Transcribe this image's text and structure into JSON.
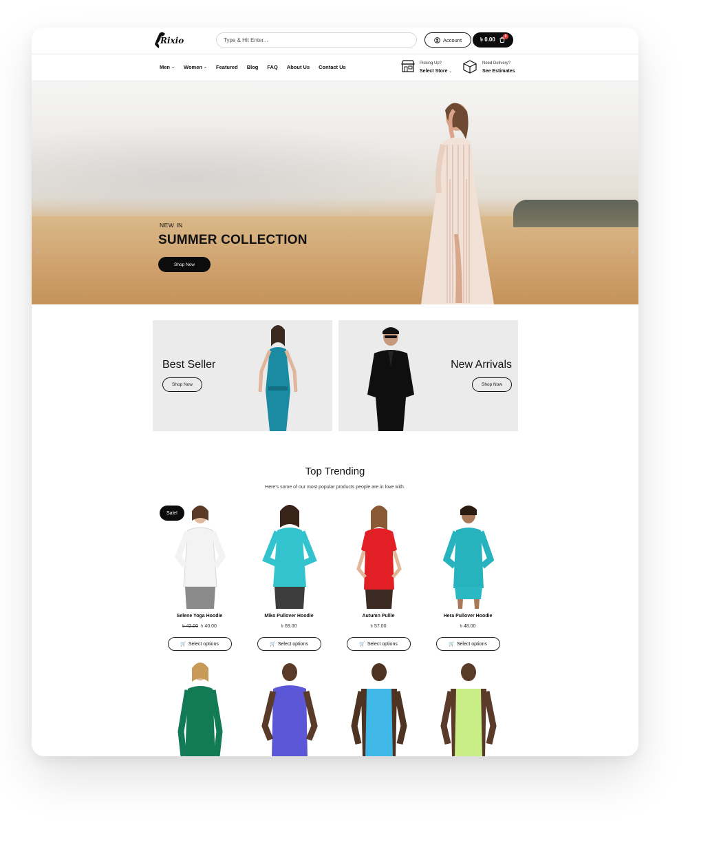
{
  "brand": {
    "logo_text": "Rixio"
  },
  "header": {
    "search_placeholder": "Type & Hit Enter...",
    "account_label": "Account",
    "cart_total": "৳ 0.00",
    "cart_count": "0"
  },
  "nav": {
    "items": [
      {
        "label": "Men",
        "has_dropdown": true
      },
      {
        "label": "Women",
        "has_dropdown": true
      },
      {
        "label": "Featured",
        "has_dropdown": false
      },
      {
        "label": "Blog",
        "has_dropdown": false
      },
      {
        "label": "FAQ",
        "has_dropdown": false
      },
      {
        "label": "About Us",
        "has_dropdown": false
      },
      {
        "label": "Contact Us",
        "has_dropdown": false
      }
    ],
    "store": {
      "line1": "Picking Up?",
      "line2": "Select Store"
    },
    "delivery": {
      "line1": "Need Delivery?",
      "line2": "See Estimates"
    }
  },
  "hero": {
    "kicker": "NEW IN",
    "title": "SUMMER COLLECTION",
    "button": "Shop Now"
  },
  "promos": [
    {
      "title": "Best Seller",
      "button": "Shop Now"
    },
    {
      "title": "New Arrivals",
      "button": "Shop Now"
    }
  ],
  "trending": {
    "title": "Top Trending",
    "subtitle": "Here's some of our most popular products people are in love with.",
    "sale_badge": "Sale!",
    "button_label": "Select options",
    "products": [
      {
        "name": "Selene Yoga Hoodie",
        "old_price": "৳ 42.00",
        "price": "৳ 40.00",
        "color": "#f3f3f3"
      },
      {
        "name": "Miko Pullover Hoodie",
        "old_price": "",
        "price": "৳ 69.00",
        "color": "#33c3cf"
      },
      {
        "name": "Autumn Pullie",
        "old_price": "",
        "price": "৳ 57.00",
        "color": "#e21f24"
      },
      {
        "name": "Hera Pullover Hoodie",
        "old_price": "",
        "price": "৳ 48.00",
        "color": "#27b3bd"
      }
    ],
    "row2_colors": [
      "#127a55",
      "#5c57d6",
      "#3fb8e8",
      "#c9ee86"
    ]
  }
}
